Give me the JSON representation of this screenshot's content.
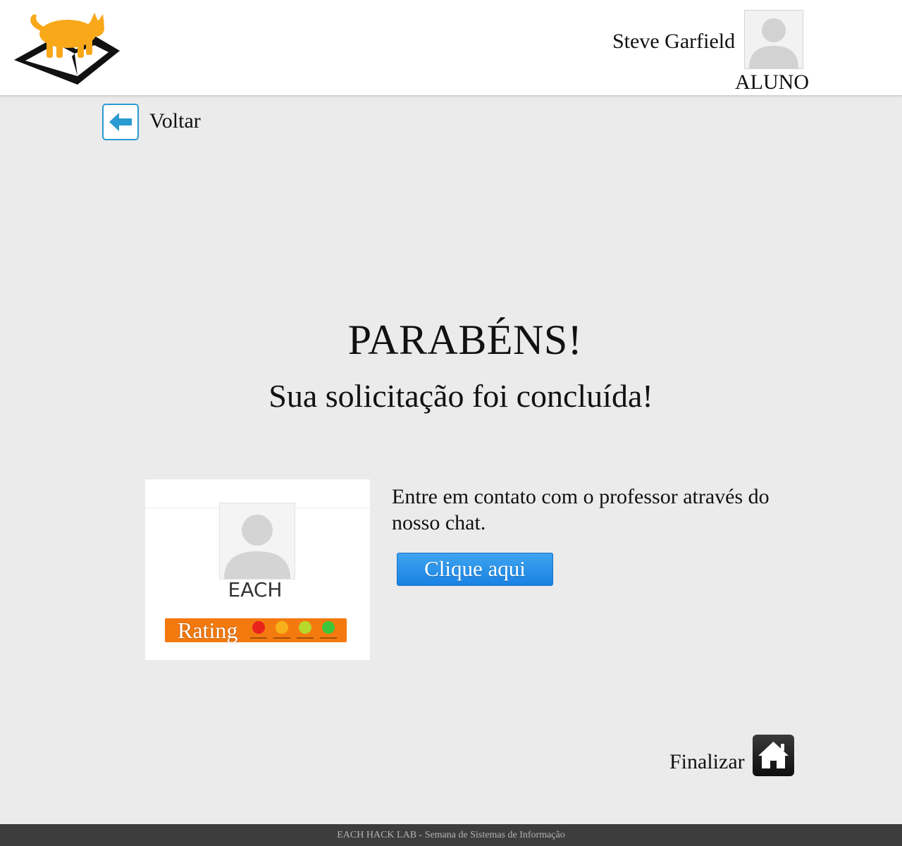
{
  "header": {
    "logo_icon": "cat-on-book-logo",
    "user_name": "Steve Garfield",
    "user_role": "ALUNO",
    "avatar_icon": "user-silhouette-icon"
  },
  "nav": {
    "back_label": "Voltar",
    "back_icon": "arrow-left-icon"
  },
  "main": {
    "title": "PARABÉNS!",
    "subtitle": "Sua solicitação foi concluída!"
  },
  "card": {
    "name": "EACH",
    "rating_label": "Rating",
    "rating_faces": [
      {
        "icon": "angry-face-icon",
        "color": "#e8231c"
      },
      {
        "icon": "sad-face-icon",
        "color": "#f7b21b"
      },
      {
        "icon": "neutral-face-icon",
        "color": "#b7d92b"
      },
      {
        "icon": "happy-face-icon",
        "color": "#3ec63a"
      }
    ]
  },
  "contact": {
    "text": "Entre em contato com o professor através do nosso chat.",
    "button_label": "Clique aqui"
  },
  "finish": {
    "label": "Finalizar",
    "icon": "home-icon"
  },
  "footer": {
    "text": "EACH HACK LAB - Semana de Sistemas de Informação"
  },
  "colors": {
    "accent_blue": "#2a9ad0",
    "button_blue": "#1a82e2",
    "rating_orange": "#f47a0f",
    "logo_orange": "#f9a81a",
    "footer_bg": "#3d3d3d",
    "page_bg": "#ebebeb"
  }
}
